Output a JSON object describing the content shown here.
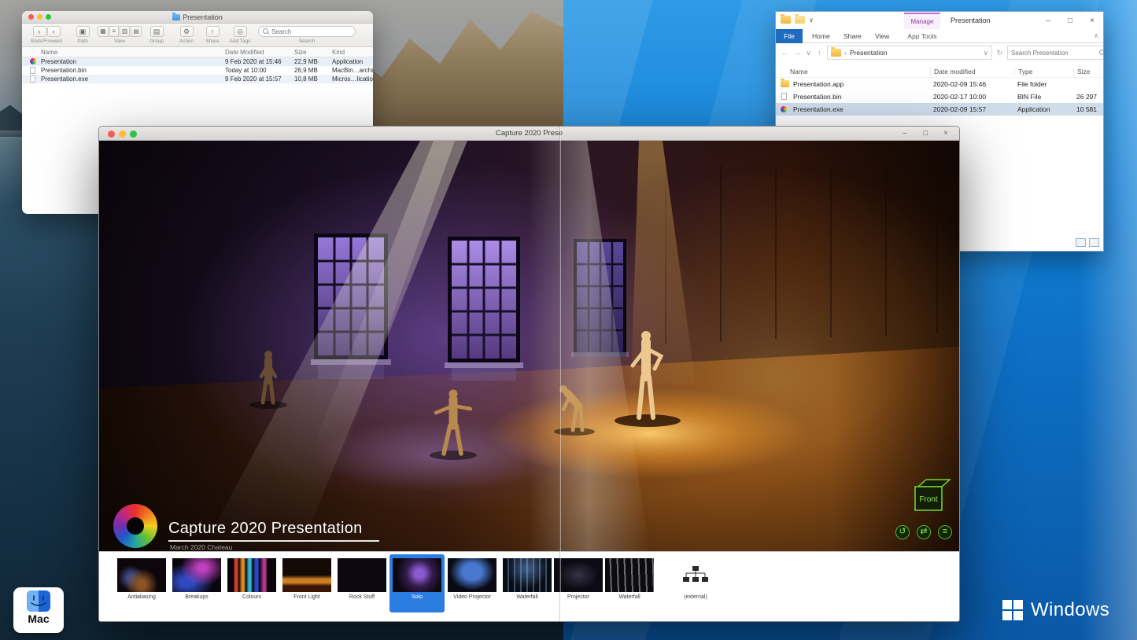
{
  "desktop": {
    "mac_label": "Mac",
    "windows_label": "Windows"
  },
  "icons": {
    "back": "‹",
    "forward": "›",
    "path": "▣",
    "view_a": "▦",
    "view_b": "▤",
    "view_c": "▥",
    "view_d": "≡",
    "group": "▤",
    "action": "⚙",
    "share": "↑",
    "add_tags": "◎",
    "win_back": "←",
    "win_forward": "→",
    "win_down": "∨",
    "win_up": "↑",
    "win_refresh": "↻",
    "chevron_right": "›",
    "address_down": "∨",
    "ribbon_collapse": "∧",
    "minimize": "–",
    "maximize": "□",
    "close": "×",
    "orbit": "↺",
    "pan": "⇄",
    "menu": "≡"
  },
  "finder": {
    "window_title": "Presentation",
    "toolbar_labels": [
      "Back/Forward",
      "Path",
      "View",
      "Group",
      "Action",
      "Share",
      "Add Tags",
      "Search"
    ],
    "search_placeholder": "Search",
    "columns": [
      "Name",
      "Date Modified",
      "Size",
      "Kind"
    ],
    "rows": [
      {
        "name": "Presentation",
        "date_modified": "9 Feb 2020 at 15:46",
        "size": "22,9 MB",
        "kind": "Application"
      },
      {
        "name": "Presentation.bin",
        "date_modified": "Today at 10:00",
        "size": "26,9 MB",
        "kind": "MacBin…archive"
      },
      {
        "name": "Presentation.exe",
        "date_modified": "9 Feb 2020 at 15:57",
        "size": "10,8 MB",
        "kind": "Micros…lication"
      }
    ]
  },
  "explorer": {
    "window_title": "Presentation",
    "manage_label": "Manage",
    "app_tools_label": "App Tools",
    "tabs": [
      "File",
      "Home",
      "Share",
      "View"
    ],
    "breadcrumb": "Presentation",
    "search_placeholder": "Search Presentation",
    "columns": [
      "Name",
      "Date modified",
      "Type",
      "Size"
    ],
    "rows": [
      {
        "name": "Presentation.app",
        "date_modified": "2020-02-09 15:46",
        "type": "File folder",
        "size": ""
      },
      {
        "name": "Presentation.bin",
        "date_modified": "2020-02-17 10:00",
        "type": "BIN File",
        "size": "26 297"
      },
      {
        "name": "Presentation.exe",
        "date_modified": "2020-02-09 15:57",
        "type": "Application",
        "size": "10 581",
        "selected": true
      }
    ]
  },
  "capture": {
    "window_title": "Capture 2020 Prese",
    "overlay_title": "Capture 2020 Presentation",
    "overlay_subtitle": "March 2020 Chateau",
    "view_label": "Front",
    "thumbnails": [
      {
        "label": "Antialiasing"
      },
      {
        "label": "Breakups"
      },
      {
        "label": "Colours"
      },
      {
        "label": "Front Light"
      },
      {
        "label": "Rock Stuff"
      },
      {
        "label": "Solo",
        "selected": true
      },
      {
        "label": "Video Projector"
      },
      {
        "label": "Waterfall"
      },
      {
        "label": "Projector"
      },
      {
        "label": "Waterfall"
      },
      {
        "label": "(external)"
      }
    ]
  }
}
